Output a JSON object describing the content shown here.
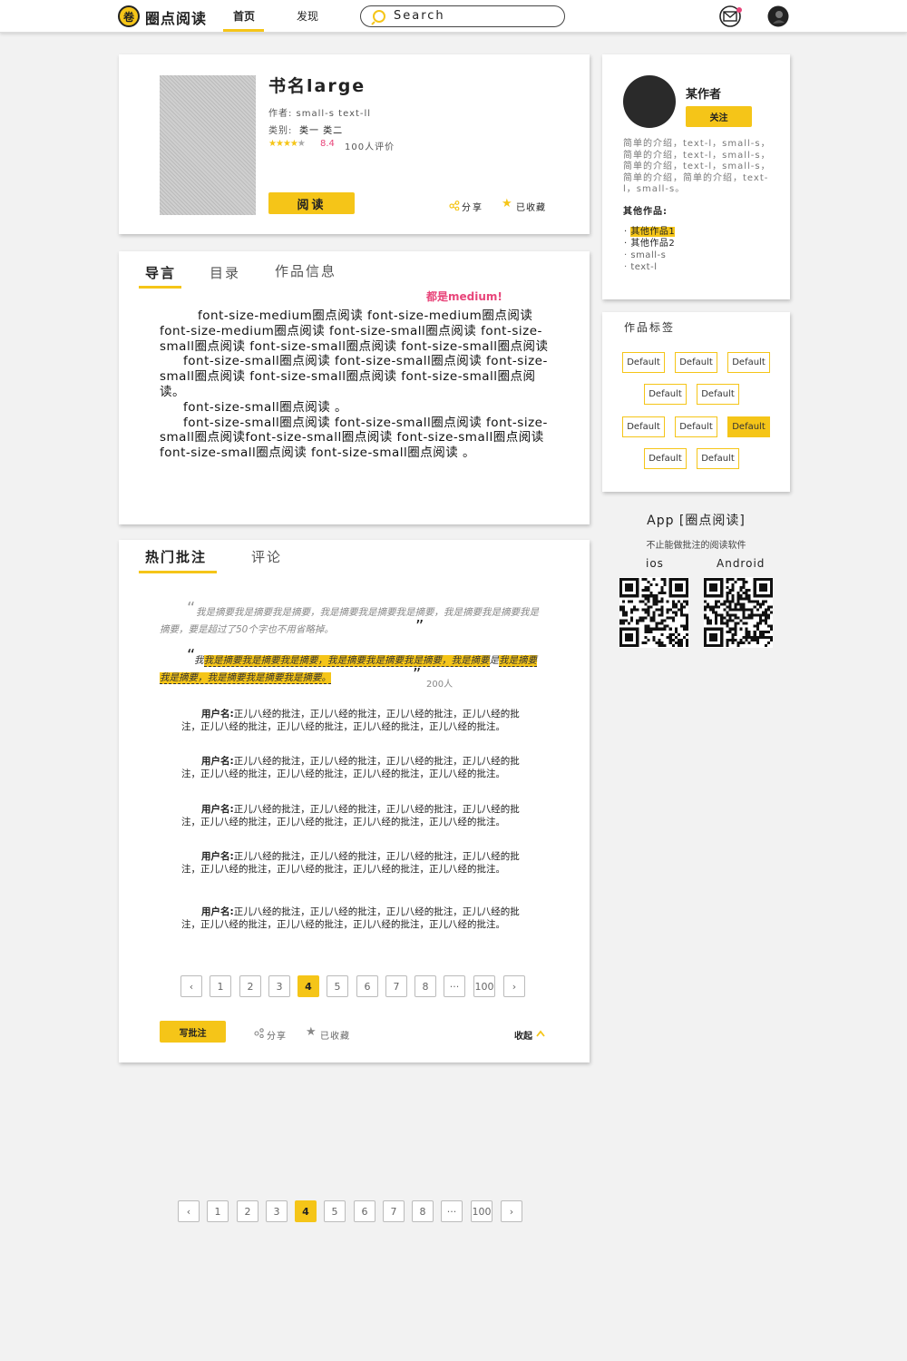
{
  "header": {
    "logo_char": "卷",
    "logo_text": "圈点阅读",
    "nav": [
      {
        "label": "首页"
      },
      {
        "label": "发现"
      }
    ],
    "search_placeholder": "Search"
  },
  "book": {
    "title": "书名large",
    "author_line": "作者: small-s text-ll",
    "category_label": "类别:",
    "categories": "类一 类二",
    "rating": "8.4",
    "rating_stars": 4,
    "review_count": "100人评价",
    "read_button": "阅读",
    "share_label": "分享",
    "collect_label": "已收藏"
  },
  "intro": {
    "tabs": [
      {
        "label": "导言"
      },
      {
        "label": "目录"
      },
      {
        "label": "作品信息"
      }
    ],
    "note": "都是medium!",
    "paragraphs": [
      "font-size-medium圈点阅读 font-size-medium圈点阅读 font-size-medium圈点阅读 font-size-small圈点阅读 font-size-small圈点阅读 font-size-small圈点阅读 font-size-small圈点阅读",
      "font-size-small圈点阅读 font-size-small圈点阅读 font-size-small圈点阅读 font-size-small圈点阅读 font-size-small圈点阅读。",
      "font-size-small圈点阅读 。",
      "font-size-small圈点阅读 font-size-small圈点阅读 font-size-small圈点阅读font-size-small圈点阅读 font-size-small圈点阅读 font-size-small圈点阅读 font-size-small圈点阅读 。"
    ]
  },
  "annotations": {
    "tabs": [
      {
        "label": "热门批注"
      },
      {
        "label": "评论"
      }
    ],
    "quote1": "我是摘要我是摘要我是摘要，我是摘要我是摘要我是摘要，我是摘要我是摘要我是摘要，要是超过了50个字也不用省略掉。",
    "quote2_prefix": "我",
    "quote2_highlight_a": "我是摘要我是摘要我是摘要，我是摘要我是摘要我是摘要，我是摘要",
    "quote2_mid": "是",
    "quote2_highlight_b": "我是摘要我是摘要，我是摘要我是摘要我是摘要。",
    "quote2_count": "200人",
    "comments": [
      {
        "user": "用户名:",
        "text": "正儿八经的批注，正儿八经的批注，正儿八经的批注，正儿八经的批注，正儿八经的批注，正儿八经的批注，正儿八经的批注，正儿八经的批注。"
      },
      {
        "user": "用户名:",
        "text": "正儿八经的批注，正儿八经的批注，正儿八经的批注，正儿八经的批注，正儿八经的批注，正儿八经的批注，正儿八经的批注，正儿八经的批注。"
      },
      {
        "user": "用户名:",
        "text": "正儿八经的批注，正儿八经的批注，正儿八经的批注，正儿八经的批注，正儿八经的批注，正儿八经的批注，正儿八经的批注，正儿八经的批注。"
      },
      {
        "user": "用户名:",
        "text": "正儿八经的批注，正儿八经的批注，正儿八经的批注，正儿八经的批注，正儿八经的批注，正儿八经的批注，正儿八经的批注，正儿八经的批注。"
      },
      {
        "user": "用户名:",
        "text": "正儿八经的批注，正儿八经的批注，正儿八经的批注，正儿八经的批注，正儿八经的批注，正儿八经的批注，正儿八经的批注，正儿八经的批注。"
      }
    ],
    "write_button": "写批注",
    "share_label": "分享",
    "collect_label": "已收藏",
    "collapse_label": "收起"
  },
  "pagination": {
    "pages": [
      "1",
      "2",
      "3",
      "4",
      "5",
      "6",
      "7",
      "8",
      "···",
      "100"
    ],
    "current": "4"
  },
  "author_card": {
    "name": "某作者",
    "follow_button": "关注",
    "bio": "简单的介绍，text-l，small-s，简单的介绍，text-l，small-s，简单的介绍，text-l，small-s，简单的介绍，简单的介绍，text-l，small-s。",
    "other_works_label": "其他作品:",
    "other_works": [
      "其他作品1",
      "其他作品2",
      "small-s",
      "text-l"
    ]
  },
  "tags": {
    "title": "作品标签",
    "rows": [
      [
        "Default",
        "Default",
        "Default"
      ],
      [
        "Default",
        "Default"
      ],
      [
        "Default",
        "Default",
        "Default"
      ],
      [
        "Default",
        "Default"
      ]
    ],
    "selected_tag": "Default"
  },
  "app_promo": {
    "title": "App [圈点阅读]",
    "subtitle": "不止能做批注的阅读软件",
    "platforms": [
      {
        "label": "ios"
      },
      {
        "label": "Android"
      }
    ]
  },
  "colors": {
    "accent": "#f5c518",
    "note": "#e8457a",
    "text": "#222222"
  }
}
